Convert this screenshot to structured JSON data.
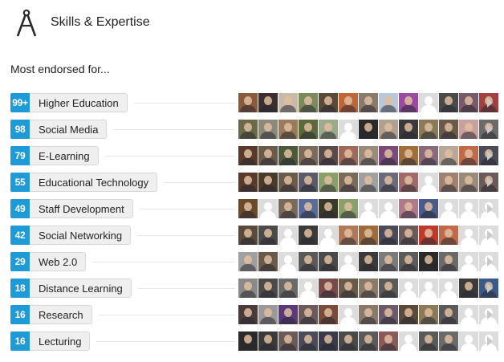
{
  "section": {
    "title": "Skills & Expertise",
    "icon": "compass-icon"
  },
  "subtitle": "Most endorsed for...",
  "colors": {
    "badge": "#1e9ad6",
    "pill_bg": "#efefef",
    "arrow": "#c9c9c9"
  },
  "skills": [
    {
      "count": "99+",
      "name": "Higher Education",
      "endorsers": [
        "#8a5a3c",
        "#3b2f2f",
        "#c9b9a8",
        "#7a8a5a",
        "#5a4a3a",
        "#c0673a",
        "#8a7a6a",
        "#b9c7d6",
        "#9a4aa0",
        "#dcdcdc",
        "#4a4a4a",
        "#7a5a6a",
        "#a04040"
      ]
    },
    {
      "count": "98",
      "name": "Social Media",
      "endorsers": [
        "#6a6a4a",
        "#8a8a7a",
        "#9a7a5a",
        "#5a6a3a",
        "#9aaa8a",
        "#dcdcdc",
        "#2a2a2a",
        "#b0a090",
        "#3a3a3a",
        "#8a7a5a",
        "#6a5a4a",
        "#c8a0a0",
        "#6a6a6a"
      ]
    },
    {
      "count": "79",
      "name": "E-Learning",
      "endorsers": [
        "#5a3a2a",
        "#6a5a4a",
        "#4a5a3a",
        "#7a6a5a",
        "#5a4a4a",
        "#a06a5a",
        "#9a8a7a",
        "#7a4a7a",
        "#a0703a",
        "#8a6a7a",
        "#b8a898",
        "#c06a4a",
        "#4a4a5a"
      ]
    },
    {
      "count": "55",
      "name": "Educational Technology",
      "endorsers": [
        "#5a3a2a",
        "#4a3a2a",
        "#6a5a4a",
        "#5a5a6a",
        "#8aa06a",
        "#7a6a5a",
        "#a0a0a0",
        "#6a6a7a",
        "#a06a6a",
        "#dcdcdc",
        "#a08070",
        "#9a8a7a",
        "#6a5a5a"
      ]
    },
    {
      "count": "49",
      "name": "Staff Development",
      "endorsers": [
        "#6a4a2a",
        "#dcdcdc",
        "#7a6a5a",
        "#5a6a9a",
        "#3a3a2a",
        "#8aa06a",
        "#dcdcdc",
        "#dcdcdc",
        "#b07a8a",
        "#4a5a8a",
        "#dcdcdc",
        "#dcdcdc",
        "#dcdcdc"
      ]
    },
    {
      "count": "42",
      "name": "Social Networking",
      "endorsers": [
        "#5a4a3a",
        "#4a4a4a",
        "#dcdcdc",
        "#3a3a3a",
        "#dcdcdc",
        "#b07a5a",
        "#a06a3a",
        "#4a4a5a",
        "#6a5a5a",
        "#c03a2a",
        "#c06a4a",
        "#dcdcdc",
        "#dcdcdc"
      ]
    },
    {
      "count": "29",
      "name": "Web 2.0",
      "endorsers": [
        "#a0a0a0",
        "#6a5a4a",
        "#dcdcdc",
        "#5a5a5a",
        "#4a4a4a",
        "#dcdcdc",
        "#3a3a3a",
        "#7a7a7a",
        "#5a5a5a",
        "#2a2a2a",
        "#6a6a6a",
        "#dcdcdc",
        "#dcdcdc"
      ]
    },
    {
      "count": "18",
      "name": "Distance Learning",
      "endorsers": [
        "#8a8a8a",
        "#4a4a4a",
        "#6a6a6a",
        "#dcdcdc",
        "#7a4a4a",
        "#6a5a4a",
        "#8a7a6a",
        "#5a5a5a",
        "#dcdcdc",
        "#dcdcdc",
        "#dcdcdc",
        "#3a3a3a",
        "#3a5a8a"
      ]
    },
    {
      "count": "16",
      "name": "Research",
      "endorsers": [
        "#4a3a3a",
        "#9a9a9a",
        "#5a3a7a",
        "#6a5a5a",
        "#7a4a3a",
        "#dcdcdc",
        "#8a7a6a",
        "#6a5a6a",
        "#5a4a3a",
        "#8a7a5a",
        "#5a5a5a",
        "#dcdcdc",
        "#dcdcdc"
      ]
    },
    {
      "count": "16",
      "name": "Lecturing",
      "endorsers": [
        "#2a2a2a",
        "#3a3a3a",
        "#6a5a5a",
        "#4a4a5a",
        "#3a3a4a",
        "#4a4a4a",
        "#5a5a5a",
        "#8a5a5a",
        "#dcdcdc",
        "#5a5a5a",
        "#6a6a6a",
        "#dcdcdc",
        "#dcdcdc"
      ]
    }
  ]
}
